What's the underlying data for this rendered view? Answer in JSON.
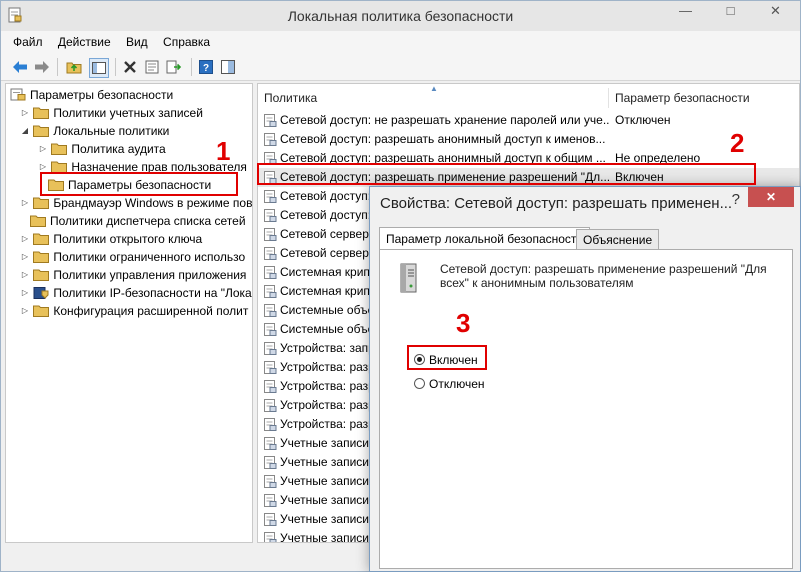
{
  "window": {
    "title": "Локальная политика безопасности",
    "controls": {
      "minimize": "—",
      "maximize": "□",
      "close": "✕"
    }
  },
  "menu": [
    "Файл",
    "Действие",
    "Вид",
    "Справка"
  ],
  "toolbar": {
    "icons": [
      "back-arrow-icon",
      "forward-arrow-icon",
      "up-folder-icon",
      "show-tree-icon",
      "delete-icon",
      "properties-icon",
      "export-icon",
      "help-icon",
      "pane-icon"
    ]
  },
  "tree": {
    "root": "Параметры безопасности",
    "items": [
      {
        "label": "Политики учетных записей"
      },
      {
        "label": "Локальные политики"
      },
      {
        "label": "Политика аудита"
      },
      {
        "label": "Назначение прав пользователя"
      },
      {
        "label": "Параметры безопасности"
      },
      {
        "label": "Брандмауэр Windows в режиме пов"
      },
      {
        "label": "Политики диспетчера списка сетей"
      },
      {
        "label": "Политики открытого ключа"
      },
      {
        "label": "Политики ограниченного использо"
      },
      {
        "label": "Политики управления приложения"
      },
      {
        "label": "Политики IP-безопасности на \"Лока"
      },
      {
        "label": "Конфигурация расширенной полит"
      }
    ]
  },
  "list": {
    "columns": [
      "Политика",
      "Параметр безопасности"
    ],
    "rows": [
      [
        "Сетевой доступ: не разрешать хранение паролей или уче...",
        "Отключен"
      ],
      [
        "Сетевой доступ: разрешать анонимный доступ к именов...",
        ""
      ],
      [
        "Сетевой доступ: разрешать анонимный доступ к общим ...",
        "Не определено"
      ],
      [
        "Сетевой доступ: разрешать применение разрешений \"Дл...",
        "Включен"
      ],
      [
        "Сетевой доступ: ра",
        ""
      ],
      [
        "Сетевой доступ: с",
        ""
      ],
      [
        "Сетевой сервер Mi",
        ""
      ],
      [
        "Сетевой сервер Mi",
        ""
      ],
      [
        "Системная крипто",
        ""
      ],
      [
        "Системная крипто",
        ""
      ],
      [
        "Системные объек",
        ""
      ],
      [
        "Системные объек",
        ""
      ],
      [
        "Устройства: запр",
        ""
      ],
      [
        "Устройства: разр",
        ""
      ],
      [
        "Устройства: разр",
        ""
      ],
      [
        "Устройства: разр",
        ""
      ],
      [
        "Устройства: разр",
        ""
      ],
      [
        "Учетные записи:",
        ""
      ],
      [
        "Учетные записи:",
        ""
      ],
      [
        "Учетные записи:",
        ""
      ],
      [
        "Учетные записи:",
        ""
      ],
      [
        "Учетные записи:",
        ""
      ],
      [
        "Учетные записи:",
        ""
      ]
    ]
  },
  "dialog": {
    "title": "Свойства: Сетевой доступ: разрешать применен...",
    "help": "?",
    "close": "✕",
    "tabs": [
      "Параметр локальной безопасности",
      "Объяснение"
    ],
    "description": "Сетевой доступ: разрешать применение разрешений \"Для всех\" к анонимным пользователям",
    "options": [
      {
        "label": "Включен",
        "selected": true
      },
      {
        "label": "Отключен",
        "selected": false
      }
    ]
  },
  "annotations": [
    "1",
    "2",
    "3"
  ],
  "colors": {
    "annotation_red": "#e00000",
    "folder_yellow": "#e8c15a",
    "close_red": "#c75050"
  }
}
